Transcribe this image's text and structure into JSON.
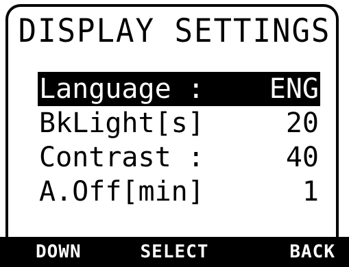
{
  "title": "DISPLAY SETTINGS",
  "menu": {
    "items": [
      {
        "label": "Language :",
        "value": "ENG"
      },
      {
        "label": "BkLight[s]",
        "value": "20"
      },
      {
        "label": "Contrast :",
        "value": "40"
      },
      {
        "label": "A.Off[min]",
        "value": "1"
      }
    ],
    "selected_index": 0
  },
  "softkeys": {
    "left": "DOWN",
    "center": "SELECT",
    "right": "BACK"
  },
  "colors": {
    "foreground": "#000000",
    "background": "#ffffff"
  }
}
